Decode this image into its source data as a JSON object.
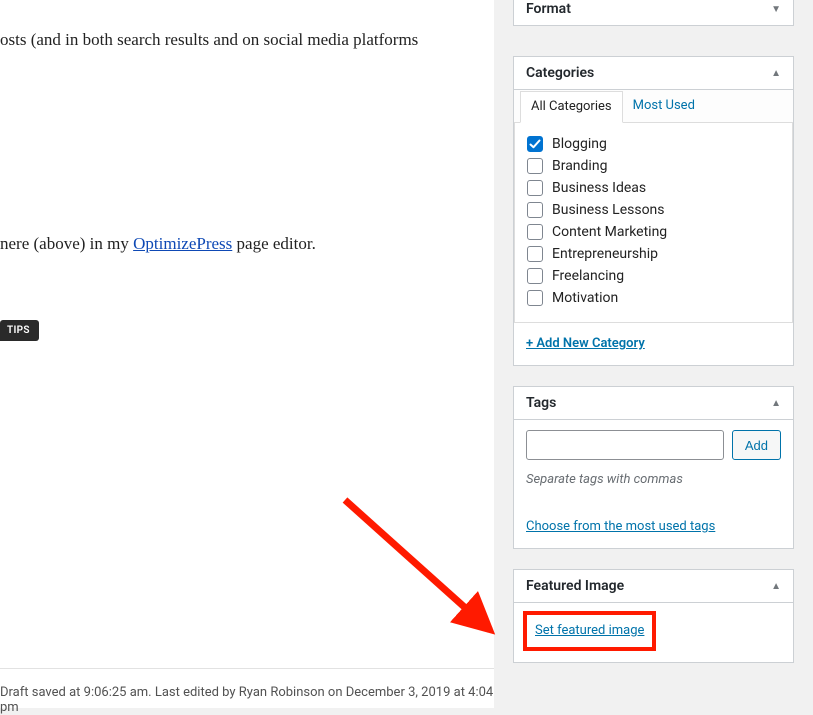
{
  "main": {
    "text1": "osts (and in both search results and on social media platforms",
    "text2_prefix": "nere (above) in my ",
    "text2_link": "OptimizePress",
    "text2_suffix": " page editor.",
    "tips_badge": "TIPS",
    "status": "Draft saved at 9:06:25 am. Last edited by Ryan Robinson on December 3, 2019 at 4:04 pm"
  },
  "format": {
    "title": "Format"
  },
  "categories": {
    "title": "Categories",
    "tab_all": "All Categories",
    "tab_most": "Most Used",
    "items": [
      {
        "label": "Blogging",
        "checked": true
      },
      {
        "label": "Branding",
        "checked": false
      },
      {
        "label": "Business Ideas",
        "checked": false
      },
      {
        "label": "Business Lessons",
        "checked": false
      },
      {
        "label": "Content Marketing",
        "checked": false
      },
      {
        "label": "Entrepreneurship",
        "checked": false
      },
      {
        "label": "Freelancing",
        "checked": false
      },
      {
        "label": "Motivation",
        "checked": false
      }
    ],
    "add_new": "+ Add New Category"
  },
  "tags": {
    "title": "Tags",
    "add_btn": "Add",
    "hint": "Separate tags with commas",
    "choose_link": "Choose from the most used tags"
  },
  "featured": {
    "title": "Featured Image",
    "link": "Set featured image"
  },
  "colors": {
    "annotation": "#ff1a00"
  }
}
